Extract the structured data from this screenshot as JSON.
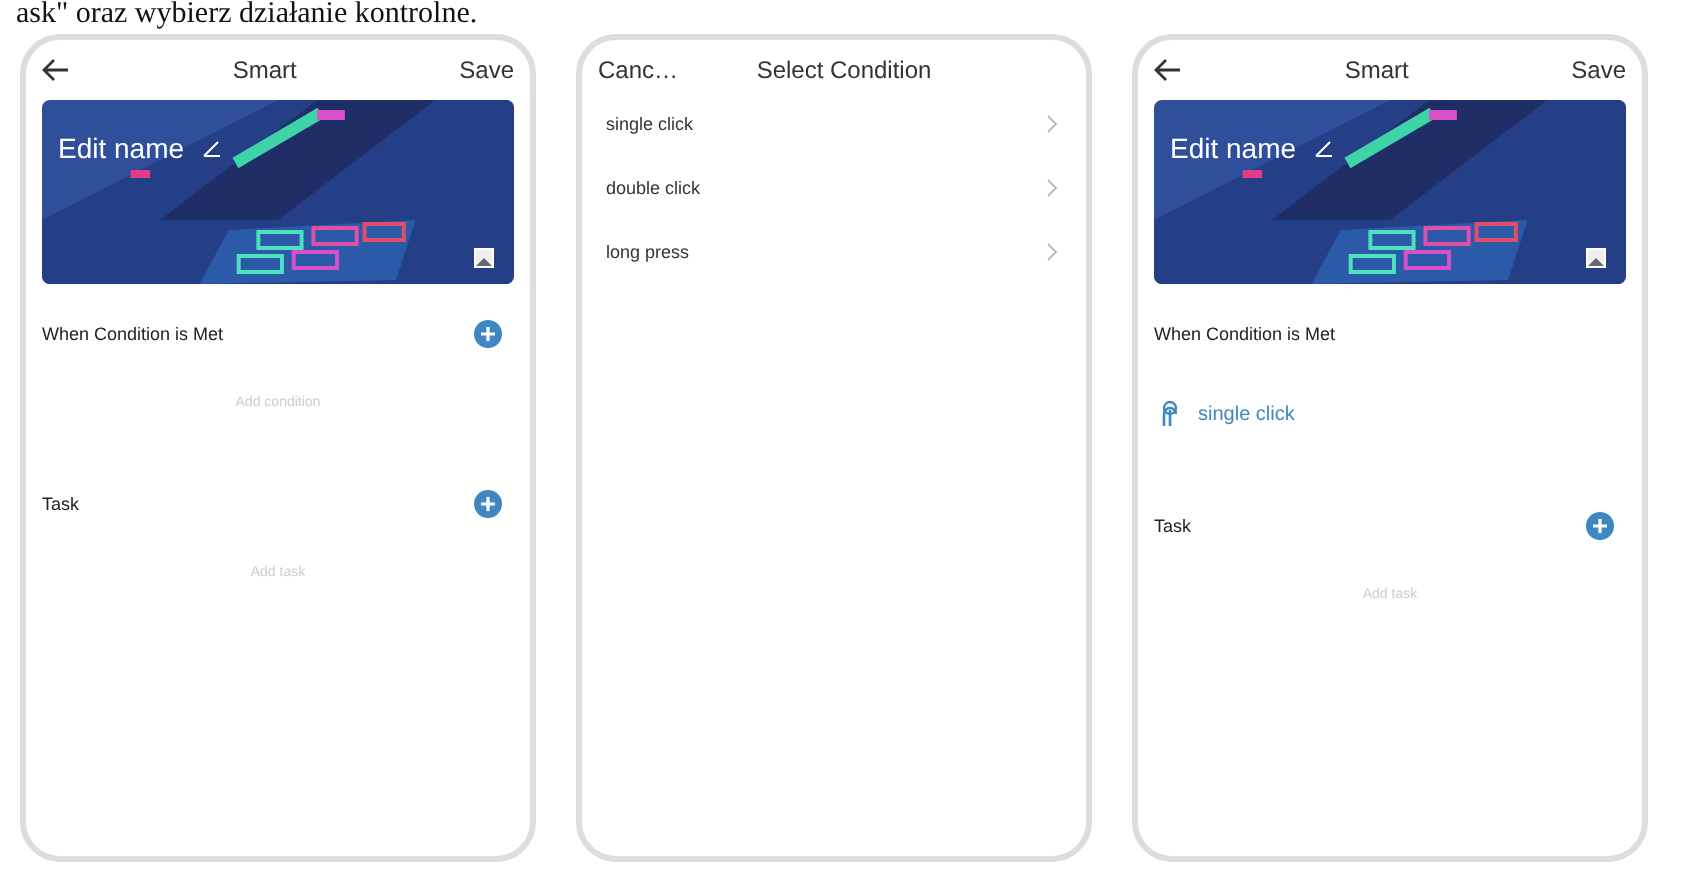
{
  "caption": "ask\" oraz wybierz działanie kontrolne.",
  "phones": [
    {
      "kind": "scene",
      "title": "Smart",
      "action": "Save",
      "banner": {
        "label": "Edit name"
      },
      "sections": [
        {
          "title": "When Condition is Met",
          "add_button": true,
          "hint": "Add condition"
        },
        {
          "title": "Task",
          "add_button": true,
          "hint": "Add task"
        }
      ]
    },
    {
      "kind": "select",
      "cancel": "Canc…",
      "title": "Select Condition",
      "options": [
        "single click",
        "double click",
        "long press"
      ]
    },
    {
      "kind": "scene",
      "title": "Smart",
      "action": "Save",
      "banner": {
        "label": "Edit name"
      },
      "sections": [
        {
          "title": "When Condition is Met",
          "add_button": false,
          "items": [
            "single click"
          ]
        },
        {
          "title": "Task",
          "add_button": true,
          "hint": "Add task"
        }
      ]
    }
  ]
}
